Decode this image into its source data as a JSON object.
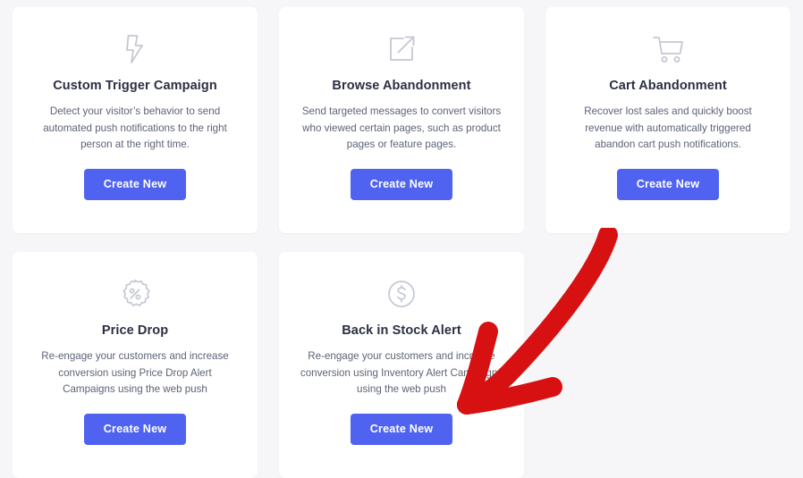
{
  "theme": {
    "page_background": "#f6f6f9",
    "card_background": "#ffffff",
    "button_color": "#4f63f0",
    "button_text_color": "#ffffff",
    "title_color": "#2b2f42",
    "description_color": "#5d6378",
    "icon_color": "#c5c7d4",
    "annotation_arrow_color": "#d71111"
  },
  "cards": [
    {
      "icon": "lightning-bolt-icon",
      "title": "Custom Trigger Campaign",
      "description": "Detect your visitor’s behavior to send automated push notifications to the right person at the right time.",
      "button_label": "Create New"
    },
    {
      "icon": "external-link-icon",
      "title": "Browse Abandonment",
      "description": "Send targeted messages to convert visitors who viewed certain pages, such as product pages or feature pages.",
      "button_label": "Create New"
    },
    {
      "icon": "shopping-cart-icon",
      "title": "Cart Abandonment",
      "description": "Recover lost sales and quickly boost revenue with automatically triggered abandon cart push notifications.",
      "button_label": "Create New"
    },
    {
      "icon": "percent-badge-icon",
      "title": "Price Drop",
      "description": "Re-engage your customers and increase conversion using Price Drop Alert Campaigns using the web push",
      "button_label": "Create New"
    },
    {
      "icon": "dollar-circle-icon",
      "title": "Back in Stock Alert",
      "description": "Re-engage your customers and increase conversion using Inventory Alert Campaigns using the web push",
      "button_label": "Create New"
    }
  ],
  "annotation": {
    "name": "red-arrow-annotation",
    "points_to": "Back in Stock Alert Create New button",
    "color": "#d71111"
  }
}
